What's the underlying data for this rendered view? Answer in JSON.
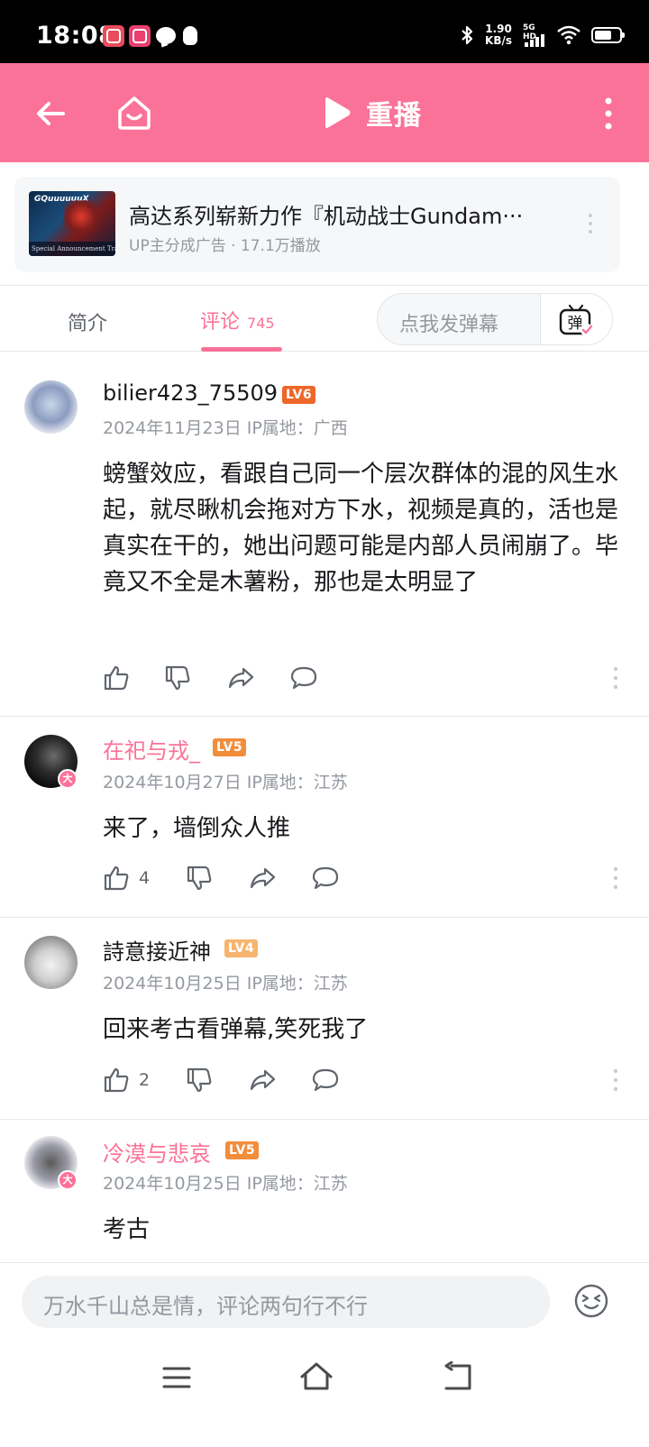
{
  "status_bar": {
    "time": "18:08",
    "net_speed": "1.90",
    "net_unit": "KB/s",
    "network_label": "5G HD"
  },
  "header": {
    "replay_label": "重播"
  },
  "ad": {
    "thumb_logo": "GQuuuuuuX",
    "thumb_caption": "Special Announcement Trailer",
    "title": "高达系列崭新力作『机动战士Gundam···",
    "subtitle": "UP主分成广告 · 17.1万播放"
  },
  "tabs": {
    "intro_label": "简介",
    "comments_label": "评论",
    "comments_count": "745",
    "danmaku_placeholder": "点我发弹幕",
    "danmaku_icon_char": "弹"
  },
  "comments": [
    {
      "username": "bilier423_75509",
      "level": "LV6",
      "meta": "2024年11月23日 IP属地：广西",
      "text": "螃蟹效应，看跟自己同一个层次群体的混的风生水起，就尽瞅机会拖对方下水，视频是真的，活也是真实在干的，她出问题可能是内部人员闹崩了。毕竟又不全是木薯粉，那也是太明显了",
      "likes": ""
    },
    {
      "username": "在祀与戎_",
      "level": "LV5",
      "meta": "2024年10月27日 IP属地：江苏",
      "text": "来了，墙倒众人推",
      "likes": "4"
    },
    {
      "username": "詩意接近神",
      "level": "LV4",
      "meta": "2024年10月25日 IP属地：江苏",
      "text": "回来考古看弹幕,笑死我了",
      "likes": "2"
    },
    {
      "username": "冷漠与悲哀",
      "level": "LV5",
      "meta": "2024年10月25日 IP属地：江苏",
      "text": "考古",
      "likes": ""
    }
  ],
  "badge_label": "大",
  "reply": {
    "placeholder": "万水千山总是情，评论两句行不行"
  },
  "colors": {
    "brand_pink": "#fb7299",
    "lv6_red": "#ee672a",
    "lv5_orange": "#f28d3c",
    "lv4_light": "#f6b56f",
    "gray_text": "#9499a0"
  }
}
